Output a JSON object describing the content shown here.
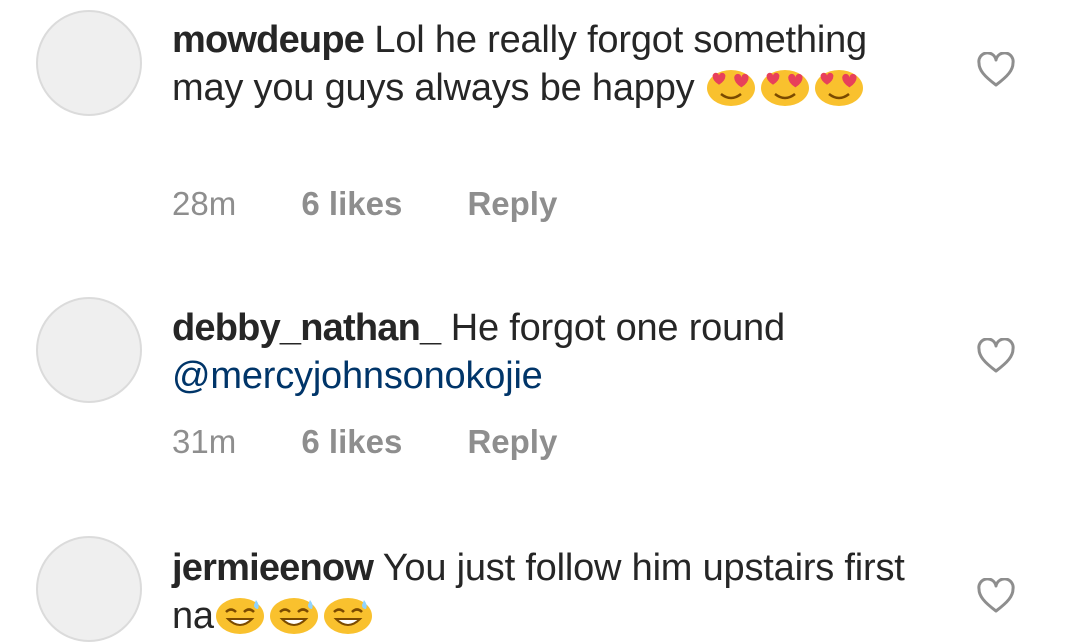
{
  "comments": [
    {
      "username": "mowdeupe",
      "text": "Lol he really forgot something may you guys always be happy",
      "mention": "",
      "emojis": [
        "smiling-face-with-heart-eyes-icon",
        "smiling-face-with-heart-eyes-icon",
        "smiling-face-with-heart-eyes-icon"
      ],
      "time": "28m",
      "likes": "6 likes",
      "reply": "Reply"
    },
    {
      "username": "debby_nathan_",
      "text": "He forgot one round",
      "mention": "@mercyjohnsonokojie",
      "emojis": [],
      "time": "31m",
      "likes": "6 likes",
      "reply": "Reply"
    },
    {
      "username": "jermieenow",
      "text": "You just follow him upstairs first na",
      "mention": "",
      "emojis": [
        "grinning-face-with-sweat-icon",
        "grinning-face-with-sweat-icon",
        "grinning-face-with-sweat-icon"
      ],
      "time": "",
      "likes": "",
      "reply": ""
    }
  ],
  "icons": {
    "like": "heart-outline-icon"
  },
  "colors": {
    "mention": "#003569",
    "meta": "#8e8e8e",
    "text": "#262626",
    "emoji": "#f9c12e",
    "heart_eyes": "#e8405a"
  }
}
